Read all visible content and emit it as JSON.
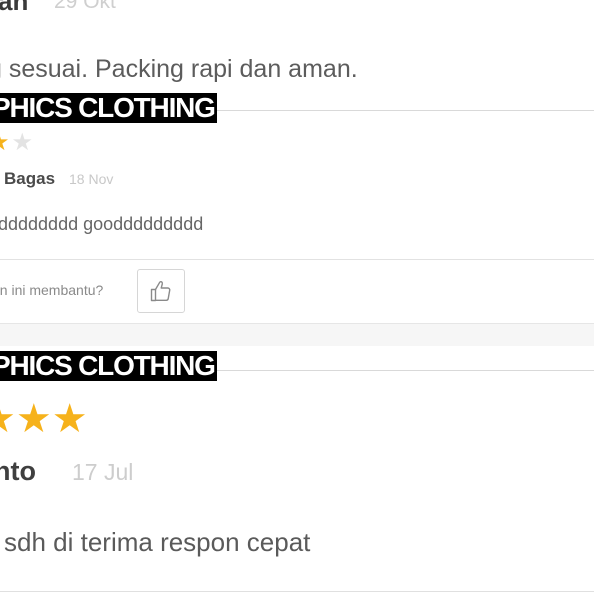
{
  "reviews": [
    {
      "store_label": "",
      "reviewer": "an",
      "date": "29 Okt",
      "text": "g sesuai. Packing rapi dan aman."
    },
    {
      "store_label": "PHICS CLOTHING",
      "rating_visible": {
        "gold": 1,
        "grey": 1
      },
      "reviewer": "Bagas",
      "date": "18 Nov",
      "text": "dddddddd gooddddddddd",
      "helpful_prompt": "an ini membantu?",
      "like_icon": "thumbs-up-icon"
    },
    {
      "store_label": "PHICS CLOTHING",
      "rating_visible": {
        "gold": 3,
        "grey": 0
      },
      "reviewer": "nto",
      "date": "17 Jul",
      "text": "sdh di terima respon cepat"
    }
  ],
  "colors": {
    "star": "#f6b21b",
    "star_empty": "#e3e3e3",
    "label_bg": "#000000",
    "label_fg": "#ffffff"
  }
}
